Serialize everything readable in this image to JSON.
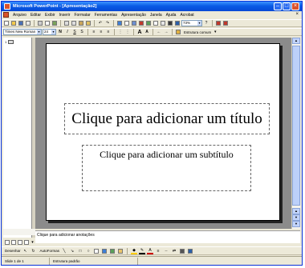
{
  "window": {
    "title": "Microsoft PowerPoint - [Apresentação2]",
    "controls": [
      "minimize-icon",
      "maximize-icon",
      "close-icon"
    ]
  },
  "menu": {
    "items": [
      "Arquivo",
      "Editar",
      "Exibir",
      "Inserir",
      "Formatar",
      "Ferramentas",
      "Apresentação",
      "Janela",
      "Ajuda",
      "Acrobat"
    ],
    "close_doc": "×"
  },
  "toolbar_standard": {
    "zoom": "73%"
  },
  "toolbar_formatting": {
    "font": "Times New Roman",
    "size": "24",
    "bold": "N",
    "italic": "I",
    "underline": "S",
    "shadow": "S",
    "grow_font": "A",
    "shrink_font": "A",
    "design_label": "Estrutura comum"
  },
  "slide": {
    "title_placeholder": "Clique para adicionar um título",
    "subtitle_placeholder": "Clique para adicionar um subtítulo"
  },
  "outline": {
    "slide_number": "1"
  },
  "notes": {
    "placeholder": "Clique para adicionar anotações"
  },
  "drawing_toolbar": {
    "draw_label": "Desenhar",
    "autoshapes_label": "AutoFormas"
  },
  "status": {
    "slide": "Slide 1 de 1",
    "design": "Estrutura padrão"
  },
  "colors": {
    "titlebar": "#0a5be6",
    "chrome": "#ece9d8",
    "slide_bg": "#8b8b8b"
  }
}
